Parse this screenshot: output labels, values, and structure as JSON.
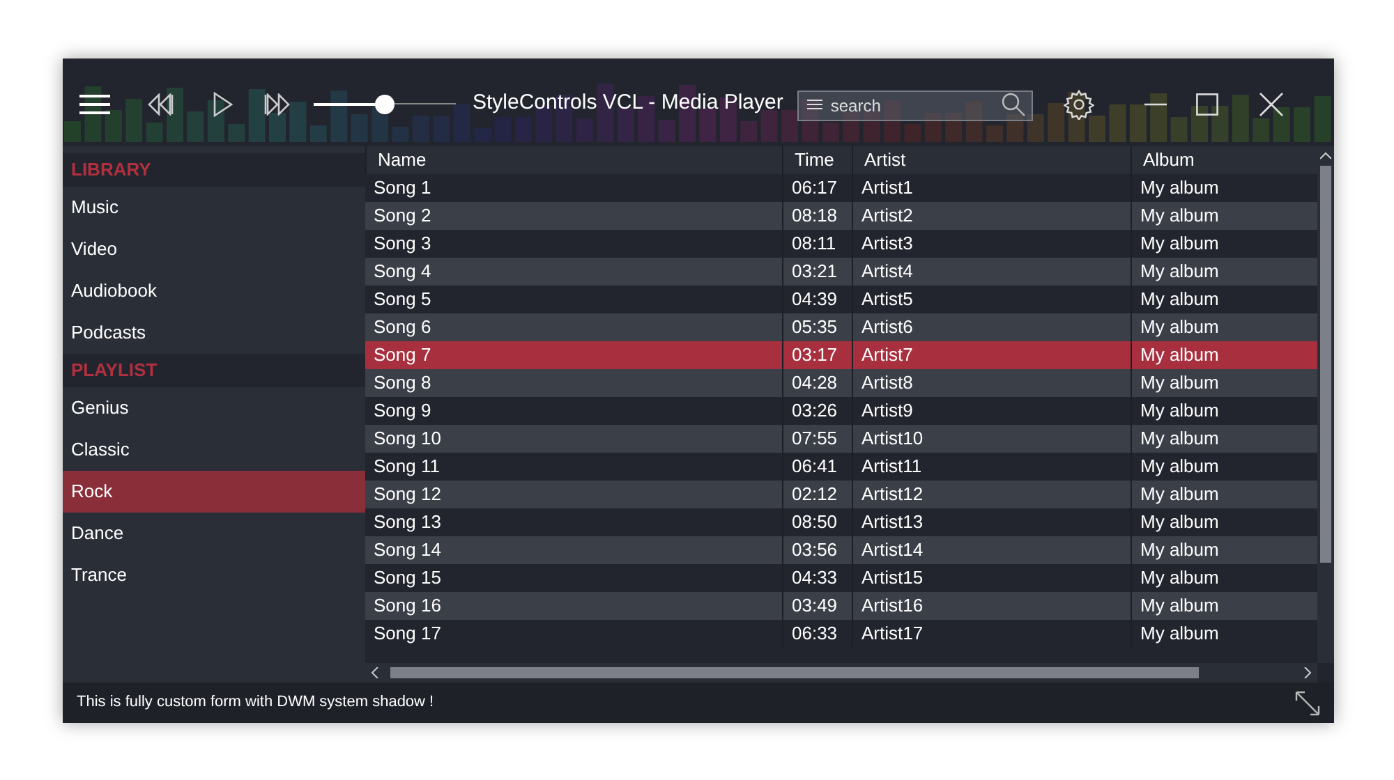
{
  "window": {
    "title": "StyleControls VCL - Media Player"
  },
  "volume": {
    "level": 0.5
  },
  "search": {
    "placeholder": "search"
  },
  "sidebar": [
    {
      "heading": "LIBRARY",
      "items": [
        {
          "label": "Music",
          "selected": false
        },
        {
          "label": "Video",
          "selected": false
        },
        {
          "label": "Audiobook",
          "selected": false
        },
        {
          "label": "Podcasts",
          "selected": false
        }
      ]
    },
    {
      "heading": "PLAYLIST",
      "items": [
        {
          "label": "Genius",
          "selected": false
        },
        {
          "label": "Classic",
          "selected": false
        },
        {
          "label": "Rock",
          "selected": true
        },
        {
          "label": "Dance",
          "selected": false
        },
        {
          "label": "Trance",
          "selected": false
        }
      ]
    }
  ],
  "table": {
    "columns": [
      "Name",
      "Time",
      "Artist",
      "Album"
    ],
    "rows": [
      {
        "cells": [
          "Song 1",
          "06:17",
          "Artist1",
          "My album"
        ],
        "selected": false
      },
      {
        "cells": [
          "Song 2",
          "08:18",
          "Artist2",
          "My album"
        ],
        "selected": false
      },
      {
        "cells": [
          "Song 3",
          "08:11",
          "Artist3",
          "My album"
        ],
        "selected": false
      },
      {
        "cells": [
          "Song 4",
          "03:21",
          "Artist4",
          "My album"
        ],
        "selected": false
      },
      {
        "cells": [
          "Song 5",
          "04:39",
          "Artist5",
          "My album"
        ],
        "selected": false
      },
      {
        "cells": [
          "Song 6",
          "05:35",
          "Artist6",
          "My album"
        ],
        "selected": false
      },
      {
        "cells": [
          "Song 7",
          "03:17",
          "Artist7",
          "My album"
        ],
        "selected": true
      },
      {
        "cells": [
          "Song 8",
          "04:28",
          "Artist8",
          "My album"
        ],
        "selected": false
      },
      {
        "cells": [
          "Song 9",
          "03:26",
          "Artist9",
          "My album"
        ],
        "selected": false
      },
      {
        "cells": [
          "Song 10",
          "07:55",
          "Artist10",
          "My album"
        ],
        "selected": false
      },
      {
        "cells": [
          "Song 11",
          "06:41",
          "Artist11",
          "My album"
        ],
        "selected": false
      },
      {
        "cells": [
          "Song 12",
          "02:12",
          "Artist12",
          "My album"
        ],
        "selected": false
      },
      {
        "cells": [
          "Song 13",
          "08:50",
          "Artist13",
          "My album"
        ],
        "selected": false
      },
      {
        "cells": [
          "Song 14",
          "03:56",
          "Artist14",
          "My album"
        ],
        "selected": false
      },
      {
        "cells": [
          "Song 15",
          "04:33",
          "Artist15",
          "My album"
        ],
        "selected": false
      },
      {
        "cells": [
          "Song 16",
          "03:49",
          "Artist16",
          "My album"
        ],
        "selected": false
      },
      {
        "cells": [
          "Song 17",
          "06:33",
          "Artist17",
          "My album"
        ],
        "selected": false
      }
    ]
  },
  "status_bar": {
    "text": "This is fully custom form with DWM system shadow !"
  }
}
